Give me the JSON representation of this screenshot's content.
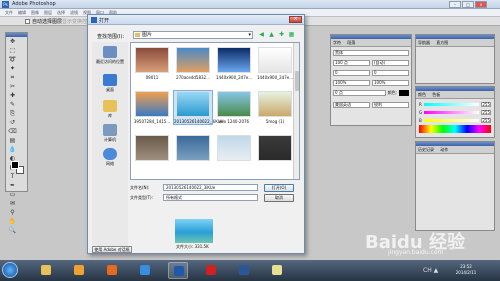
{
  "app": {
    "title": "Adobe Photoshop",
    "menu_items": [
      "文件",
      "编辑",
      "图像",
      "图层",
      "选择",
      "滤镜",
      "视图",
      "窗口",
      "帮助"
    ],
    "options_bar": {
      "auto_select_label": "自动选择图层",
      "show_transform_label": "显示变换控件"
    }
  },
  "toolbox": {
    "tools": [
      "move-tool",
      "marquee-tool",
      "lasso-tool",
      "magic-wand-tool",
      "crop-tool",
      "slice-tool",
      "healing-tool",
      "brush-tool",
      "stamp-tool",
      "history-brush-tool",
      "eraser-tool",
      "gradient-tool",
      "blur-tool",
      "dodge-tool",
      "path-select-tool",
      "type-tool",
      "pen-tool",
      "shape-tool",
      "notes-tool",
      "eyedropper-tool",
      "hand-tool",
      "zoom-tool"
    ],
    "foreground_color": "#000000",
    "background_color": "#ffffff"
  },
  "panels": {
    "character": {
      "tabs": [
        "字符",
        "段落"
      ],
      "font_label": "黑体",
      "size": "100 点",
      "leading": "(自动)",
      "tracking": "0",
      "scale_v": "100%",
      "scale_h": "100%",
      "baseline": "0 点",
      "color_label": "颜色:",
      "aa": "锐利",
      "lang": "美国英语"
    },
    "navigator": {
      "tabs": [
        "导航器",
        "直方图"
      ]
    },
    "color": {
      "tabs": [
        "颜色",
        "色板"
      ],
      "r": "255",
      "g": "255",
      "b": "255"
    },
    "history": {
      "tabs": [
        "历史记录",
        "动作"
      ]
    }
  },
  "dialog": {
    "title": "打开",
    "look_in_label": "查找范围(I):",
    "look_in_value": "图片",
    "places": [
      "最近访问的位置",
      "桌面",
      "库",
      "计算机",
      "网络"
    ],
    "files": [
      {
        "name": "09011",
        "color_a": "#8a4a3a",
        "color_b": "#d9a07a"
      },
      {
        "name": "270acedd5832...",
        "color_a": "#4a88c8",
        "color_b": "#e0a060"
      },
      {
        "name": "1440x900_2d7e...",
        "color_a": "#0b2a66",
        "color_b": "#6aa8f0"
      },
      {
        "name": "1440x900_2d7e...",
        "color_a": "#ffffff",
        "color_b": "#e5e5e5"
      },
      {
        "name": "39507284_1415...",
        "color_a": "#f0a050",
        "color_b": "#3a7ac0"
      },
      {
        "name": "20130526140022_3iKUe",
        "color_a": "#9ad8f5",
        "color_b": "#2a9ad0",
        "selected": true
      },
      {
        "name": "ello 1240-2076",
        "color_a": "#86c6e6",
        "color_b": "#4a8a4a"
      },
      {
        "name": "5mog (1)",
        "color_a": "#e8f2e0",
        "color_b": "#c9a86a"
      },
      {
        "name": "",
        "color_a": "#6a5a4a",
        "color_b": "#a09080"
      },
      {
        "name": "",
        "color_a": "#3a6a9a",
        "color_b": "#7aa0c0"
      },
      {
        "name": "",
        "color_a": "#c0d8e8",
        "color_b": "#e8eef2"
      },
      {
        "name": "",
        "color_a": "#3a3a3a",
        "color_b": "#2a2a2a"
      }
    ],
    "filename_label": "文件名(N):",
    "filename_value": "20130526140022_3iKUe",
    "filetype_label": "文件类型(T):",
    "filetype_value": "所有格式",
    "open_button": "打开(O)",
    "cancel_button": "取消",
    "file_size": "文件大小: 331.5K",
    "adobe_dialog_button": "使用 Adobe 对话框"
  },
  "taskbar": {
    "apps": [
      {
        "name": "explorer-app",
        "color": "#e8c15a"
      },
      {
        "name": "media-player-app",
        "color": "#f0a030"
      },
      {
        "name": "firefox-app",
        "color": "#e86a20"
      },
      {
        "name": "ie-app",
        "color": "#3a8ee0"
      },
      {
        "name": "photoshop-app",
        "color": "#1f5aa8",
        "active": true
      },
      {
        "name": "record-app",
        "color": "#d02020"
      },
      {
        "name": "word-app",
        "color": "#2b5797"
      },
      {
        "name": "lamp-app",
        "color": "#e8e090"
      }
    ],
    "time": "23:52",
    "date": "2014/2/11",
    "tray_text": "CH ▲"
  },
  "watermark": {
    "brand": "Baidu 经验",
    "url": "jingyan.baidu.com"
  }
}
